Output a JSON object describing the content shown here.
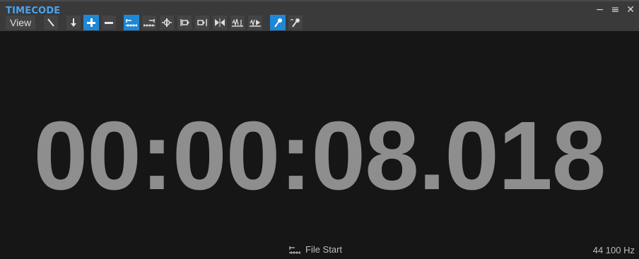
{
  "window": {
    "title": "TIMECODE",
    "controls": {
      "minimize": "−",
      "options": "≡",
      "close": "✕"
    }
  },
  "toolbar": {
    "view_label": "View",
    "buttons": [
      {
        "icon": "cursor-line-icon",
        "active": false
      },
      {
        "icon": "arrow-down-icon",
        "active": false
      },
      {
        "icon": "plus-icon",
        "active": true
      },
      {
        "icon": "minus-icon",
        "active": false
      },
      {
        "icon": "file-start-ruler-icon",
        "active": true
      },
      {
        "icon": "file-end-ruler-icon",
        "active": false
      },
      {
        "icon": "cursor-position-icon",
        "active": false
      },
      {
        "icon": "selection-start-icon",
        "active": false
      },
      {
        "icon": "selection-end-icon",
        "active": false
      },
      {
        "icon": "region-icon",
        "active": false
      },
      {
        "icon": "playback-start-icon",
        "active": false
      },
      {
        "icon": "playback-position-icon",
        "active": false
      },
      {
        "icon": "record-mic-icon",
        "active": true
      },
      {
        "icon": "mic-settings-icon",
        "active": false
      }
    ]
  },
  "display": {
    "timecode": "00:00:08.018",
    "reference_label": "File Start",
    "sample_rate": "44 100 Hz"
  },
  "colors": {
    "accent": "#1d87d8",
    "title": "#4aa3ee",
    "timecode": "#8e8e8e",
    "background": "#161616",
    "titlebar": "#3a3a3a"
  }
}
